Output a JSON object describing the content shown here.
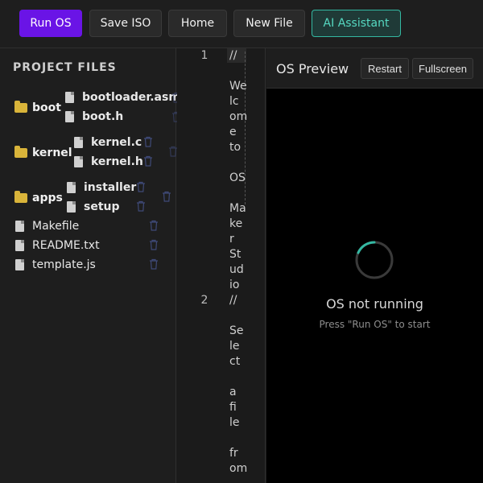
{
  "toolbar": {
    "run": "Run OS",
    "save_iso": "Save ISO",
    "home": "Home",
    "new_file": "New File",
    "ai": "AI Assistant"
  },
  "sidebar": {
    "title": "PROJECT FILES",
    "folders": [
      {
        "name": "boot",
        "files": [
          "bootloader.asm",
          "boot.h"
        ]
      },
      {
        "name": "kernel",
        "files": [
          "kernel.c",
          "kernel.h"
        ]
      },
      {
        "name": "apps",
        "files": [
          "installer",
          "setup"
        ]
      }
    ],
    "files": [
      "Makefile",
      "README.txt",
      "template.js"
    ]
  },
  "editor": {
    "line_numbers": [
      "1",
      "2"
    ],
    "fragments": [
      "//",
      "We",
      "lc",
      "om",
      "e",
      "to",
      "OS",
      "Ma",
      "ke",
      "r",
      "St",
      "ud",
      "io",
      "//",
      "Se",
      "le",
      "ct",
      "a",
      "fi",
      "le",
      "fr",
      "om"
    ]
  },
  "preview": {
    "title": "OS Preview",
    "restart": "Restart",
    "fullscreen": "Fullscreen",
    "status": "OS not running",
    "hint": "Press \"Run OS\" to start"
  },
  "colors": {
    "primary": "#6a14e6",
    "accent": "#34b8a2",
    "folder": "#d9b43a"
  },
  "icons": {
    "folder": "folder-icon",
    "file": "file-icon",
    "trash": "trash-icon",
    "spinner": "loading-spinner-icon"
  }
}
